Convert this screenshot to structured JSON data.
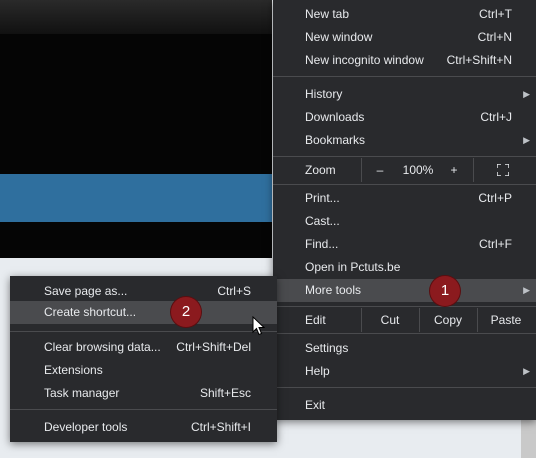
{
  "main_menu": {
    "items": [
      {
        "label": "New tab",
        "shortcut": "Ctrl+T"
      },
      {
        "label": "New window",
        "shortcut": "Ctrl+N"
      },
      {
        "label": "New incognito window",
        "shortcut": "Ctrl+Shift+N"
      },
      {
        "label": "History",
        "shortcut": ""
      },
      {
        "label": "Downloads",
        "shortcut": "Ctrl+J"
      },
      {
        "label": "Bookmarks",
        "shortcut": ""
      },
      {
        "label": "Print...",
        "shortcut": "Ctrl+P"
      },
      {
        "label": "Cast...",
        "shortcut": ""
      },
      {
        "label": "Find...",
        "shortcut": "Ctrl+F"
      },
      {
        "label": "Open in Pctuts.be",
        "shortcut": ""
      },
      {
        "label": "More tools",
        "shortcut": ""
      },
      {
        "label": "Settings",
        "shortcut": ""
      },
      {
        "label": "Help",
        "shortcut": ""
      },
      {
        "label": "Exit",
        "shortcut": ""
      }
    ],
    "zoom": {
      "label": "Zoom",
      "minus": "–",
      "value": "100%",
      "plus": "+"
    },
    "edit": {
      "label": "Edit",
      "cut": "Cut",
      "copy": "Copy",
      "paste": "Paste"
    }
  },
  "sub_menu": {
    "items": [
      {
        "label": "Save page as...",
        "shortcut": "Ctrl+S"
      },
      {
        "label": "Create shortcut...",
        "shortcut": ""
      },
      {
        "label": "Clear browsing data...",
        "shortcut": "Ctrl+Shift+Del"
      },
      {
        "label": "Extensions",
        "shortcut": ""
      },
      {
        "label": "Task manager",
        "shortcut": "Shift+Esc"
      },
      {
        "label": "Developer tools",
        "shortcut": "Ctrl+Shift+I"
      }
    ]
  },
  "badges": {
    "first": "1",
    "second": "2"
  },
  "icons": {
    "submenu_arrow": "▶",
    "fullscreen": "fullscreen-icon",
    "cursor": "mouse-pointer-icon"
  },
  "colors": {
    "menu_bg": "#292a2d",
    "highlight": "#4a4b4e",
    "badge": "#8b1a1e",
    "banner": "#2f6f9e"
  }
}
